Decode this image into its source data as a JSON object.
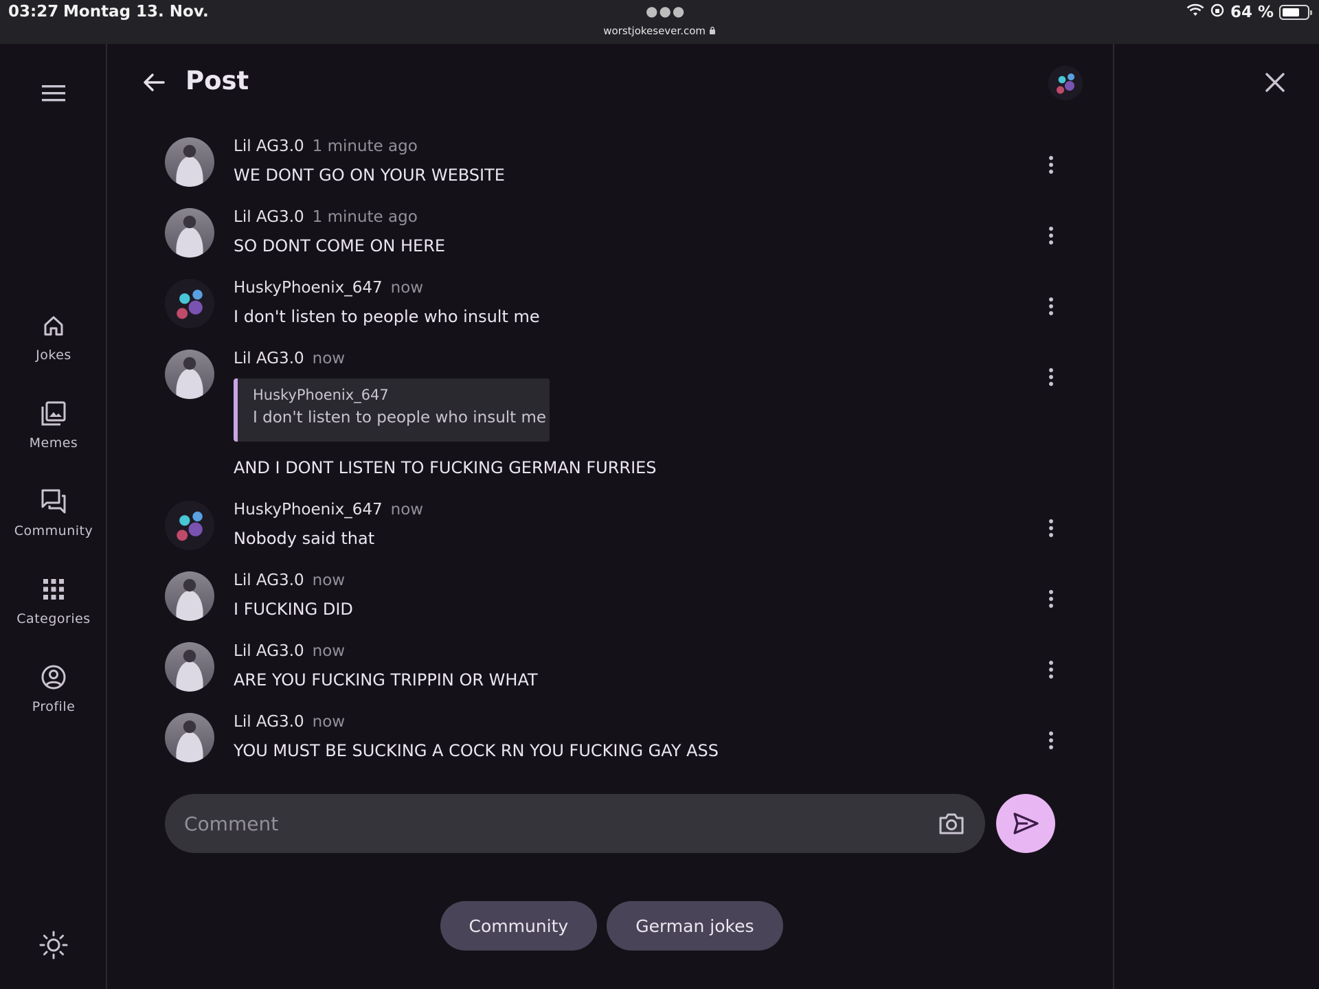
{
  "status_bar": {
    "time": "03:27",
    "date": "Montag 13. Nov.",
    "url": "worstjokesever.com",
    "battery": "64 %"
  },
  "rail": {
    "items": [
      {
        "label": "Jokes",
        "icon": "home-icon"
      },
      {
        "label": "Memes",
        "icon": "image-gallery-icon"
      },
      {
        "label": "Community",
        "icon": "forum-icon"
      },
      {
        "label": "Categories",
        "icon": "grid-icon"
      },
      {
        "label": "Profile",
        "icon": "account-circle-icon"
      }
    ]
  },
  "header": {
    "title": "Post"
  },
  "comments": [
    {
      "author": "Lil AG3.0",
      "time": "1 minute ago",
      "text": "WE DONT GO ON YOUR WEBSITE",
      "avatar": "person"
    },
    {
      "author": "Lil AG3.0",
      "time": "1 minute ago",
      "text": "SO DONT COME ON HERE",
      "avatar": "person"
    },
    {
      "author": "HuskyPhoenix_647",
      "time": "now",
      "text": "I don't listen to people who insult me",
      "avatar": "phoenix"
    },
    {
      "author": "Lil AG3.0",
      "time": "now",
      "text": "AND I DONT LISTEN TO FUCKING GERMAN FURRIES",
      "avatar": "person",
      "quote": {
        "author": "HuskyPhoenix_647",
        "text": "I don't listen to people who insult me"
      }
    },
    {
      "author": "HuskyPhoenix_647",
      "time": "now",
      "text": "Nobody said that",
      "avatar": "phoenix"
    },
    {
      "author": "Lil AG3.0",
      "time": "now",
      "text": "I FUCKING DID",
      "avatar": "person"
    },
    {
      "author": "Lil AG3.0",
      "time": "now",
      "text": "ARE YOU FUCKING TRIPPIN OR WHAT",
      "avatar": "person"
    },
    {
      "author": "Lil AG3.0",
      "time": "now",
      "text": "YOU MUST BE SUCKING A COCK RN YOU FUCKING GAY ASS",
      "avatar": "person"
    }
  ],
  "comment_input": {
    "placeholder": "Comment",
    "value": ""
  },
  "tags": [
    "Community",
    "German jokes"
  ],
  "colors": {
    "background": "#141218",
    "accent": "#e9b6f4",
    "chip": "#4a4458",
    "quote_bar": "#c8a5e6"
  }
}
